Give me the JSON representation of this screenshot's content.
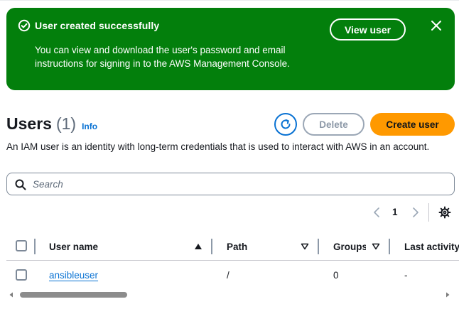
{
  "flash": {
    "title": "User created successfully",
    "message": "You can view and download the user's password and email instructions for signing in to the AWS Management Console.",
    "button_label": "View user",
    "icons": {
      "status": "check-circle-icon",
      "dismiss": "close-icon"
    },
    "background_color": "#037f0c"
  },
  "header": {
    "title": "Users",
    "count": "(1)",
    "info_label": "Info",
    "refresh_icon": "refresh-icon",
    "delete_label": "Delete",
    "create_label": "Create user",
    "accent_color": "#ff9900",
    "link_color": "#0972d3"
  },
  "description": "An IAM user is an identity with long-term credentials that is used to interact with AWS in an account.",
  "search": {
    "placeholder": "Search",
    "value": ""
  },
  "pagination": {
    "current_page": "1",
    "settings_icon": "gear-icon"
  },
  "table": {
    "columns": [
      "User name",
      "Path",
      "Groups",
      "Last activity"
    ],
    "rows": [
      {
        "user_name": "ansibleuser",
        "path": "/",
        "groups": "0",
        "last_activity": "-"
      }
    ]
  }
}
